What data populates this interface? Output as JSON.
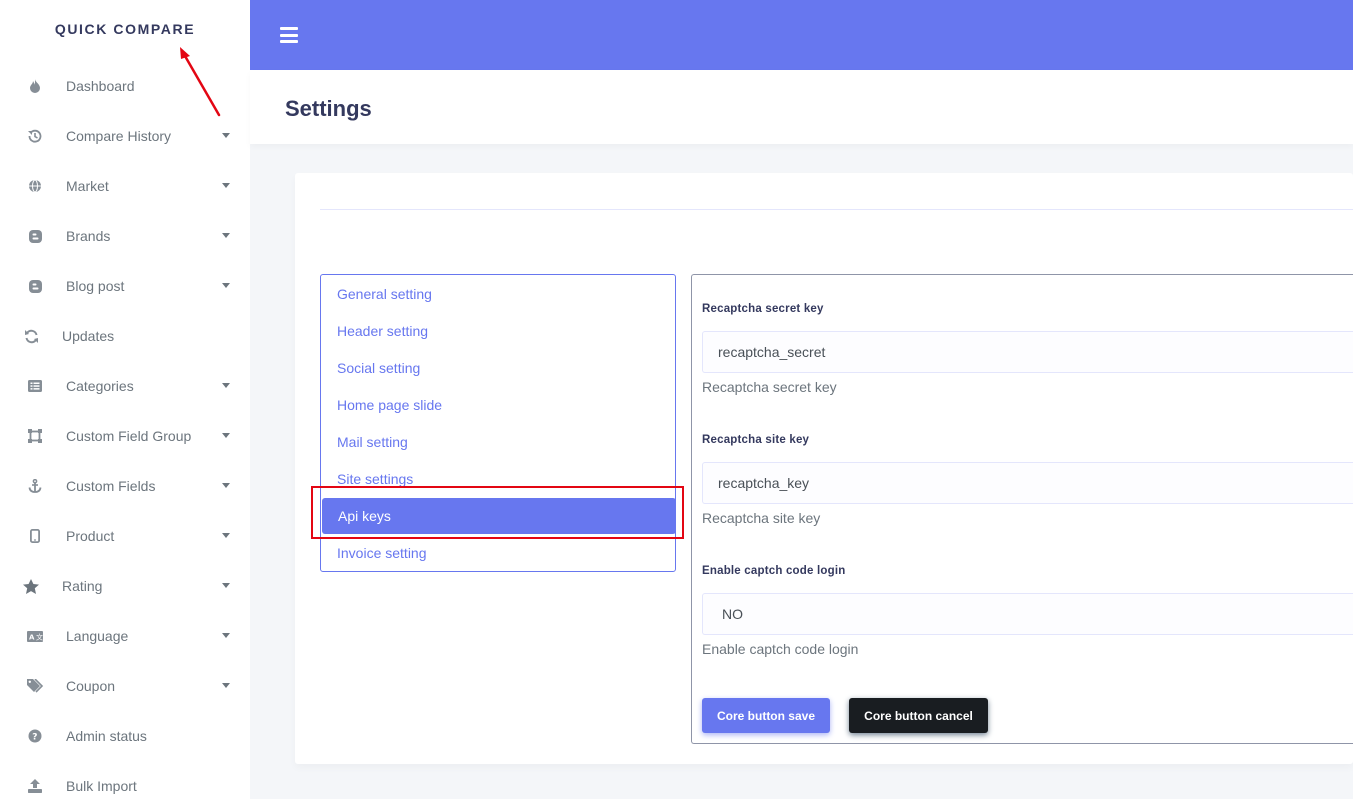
{
  "brand": {
    "name": "QUICK COMPARE"
  },
  "sidebar": {
    "items": [
      {
        "label": "Dashboard",
        "icon": "fire-icon",
        "has_caret": false
      },
      {
        "label": "Compare History",
        "icon": "history-icon",
        "has_caret": true
      },
      {
        "label": "Market",
        "icon": "globe-icon",
        "has_caret": true
      },
      {
        "label": "Brands",
        "icon": "blogger-icon",
        "has_caret": true
      },
      {
        "label": "Blog post",
        "icon": "blogger-icon",
        "has_caret": true
      },
      {
        "label": "Updates",
        "icon": "sync-icon",
        "has_caret": false
      },
      {
        "label": "Categories",
        "icon": "list-alt-icon",
        "has_caret": true
      },
      {
        "label": "Custom Field Group",
        "icon": "vector-square-icon",
        "has_caret": true
      },
      {
        "label": "Custom Fields",
        "icon": "anchor-icon",
        "has_caret": true
      },
      {
        "label": "Product",
        "icon": "mobile-icon",
        "has_caret": true
      },
      {
        "label": "Rating",
        "icon": "star-icon",
        "has_caret": true
      },
      {
        "label": "Language",
        "icon": "language-icon",
        "has_caret": true
      },
      {
        "label": "Coupon",
        "icon": "tags-icon",
        "has_caret": true
      },
      {
        "label": "Admin status",
        "icon": "question-circle-icon",
        "has_caret": false
      },
      {
        "label": "Bulk Import",
        "icon": "upload-icon",
        "has_caret": false
      }
    ]
  },
  "header": {
    "title": "Settings"
  },
  "settings_nav": {
    "items": [
      "General setting",
      "Header setting",
      "Social setting",
      "Home page slide",
      "Mail setting",
      "Site settings",
      "Api keys",
      "Invoice setting"
    ],
    "active": "Api keys"
  },
  "form": {
    "secret": {
      "label": "Recaptcha secret key",
      "value": "recaptcha_secret",
      "help": "Recaptcha secret key"
    },
    "site": {
      "label": "Recaptcha site key",
      "value": "recaptcha_key",
      "help": "Recaptcha site key"
    },
    "captcha": {
      "label": "Enable captch code login",
      "value": "NO",
      "help": "Enable captch code login"
    },
    "save_label": "Core button save",
    "cancel_label": "Core button cancel"
  },
  "colors": {
    "primary": "#6777ef",
    "annotation_red": "#e30613",
    "dark_button": "#191d21"
  }
}
